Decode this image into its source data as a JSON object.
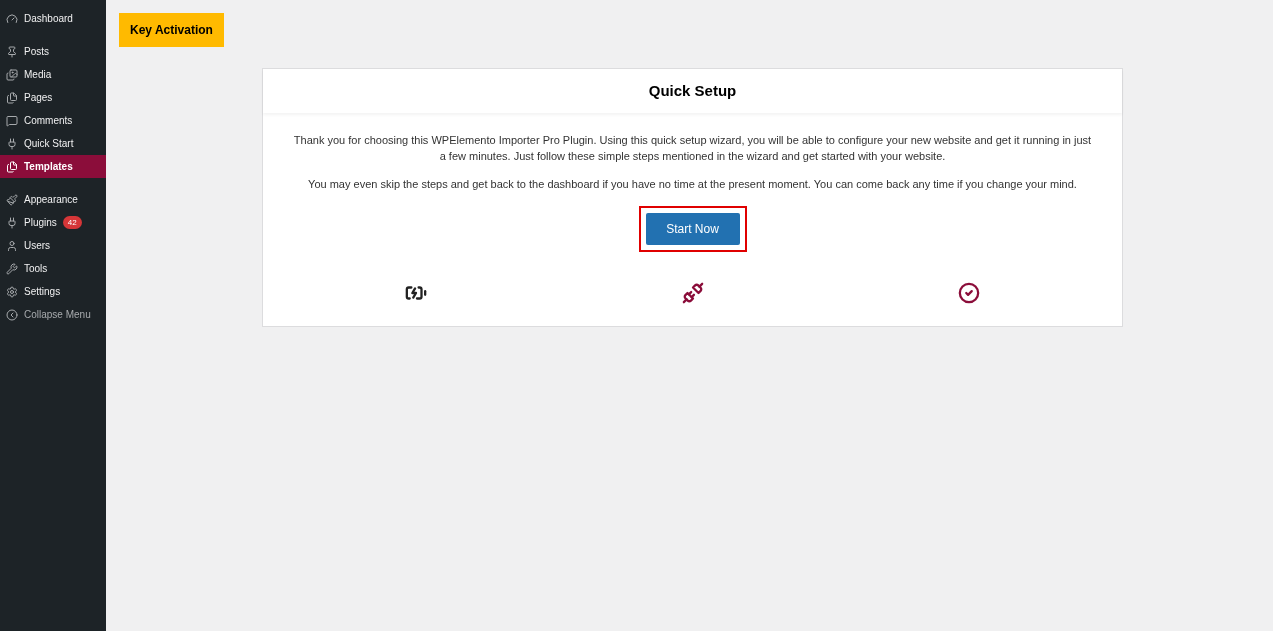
{
  "sidebar": {
    "groups": [
      [
        {
          "label": "Dashboard",
          "selected": false
        }
      ],
      [
        {
          "label": "Posts",
          "selected": false
        },
        {
          "label": "Media",
          "selected": false
        },
        {
          "label": "Pages",
          "selected": false
        },
        {
          "label": "Comments",
          "selected": false
        },
        {
          "label": "Quick Start",
          "selected": false
        },
        {
          "label": "Templates",
          "selected": true
        }
      ],
      [
        {
          "label": "Appearance",
          "selected": false
        },
        {
          "label": "Plugins",
          "selected": false,
          "badge": "42"
        },
        {
          "label": "Users",
          "selected": false
        },
        {
          "label": "Tools",
          "selected": false
        },
        {
          "label": "Settings",
          "selected": false
        },
        {
          "label": "Collapse Menu",
          "selected": false,
          "kind": "collapse"
        }
      ]
    ]
  },
  "key_activation_button": "Key Activation",
  "card": {
    "title": "Quick Setup",
    "paragraphs": [
      "Thank you for choosing this WPElemento Importer Pro Plugin. Using this quick setup wizard, you will be able to configure your new website and get it running in just a few minutes. Just follow these simple steps mentioned in the wizard and get started with your website.",
      "You may even skip the steps and get back to the dashboard if you have no time at the present moment. You can come back any time if you change your mind."
    ],
    "start_button": {
      "label": "Start Now",
      "highlighted": true
    },
    "steps": [
      {
        "color": "#222222"
      },
      {
        "color": "#8b0d3a"
      },
      {
        "color": "#8b0d3a"
      }
    ]
  }
}
